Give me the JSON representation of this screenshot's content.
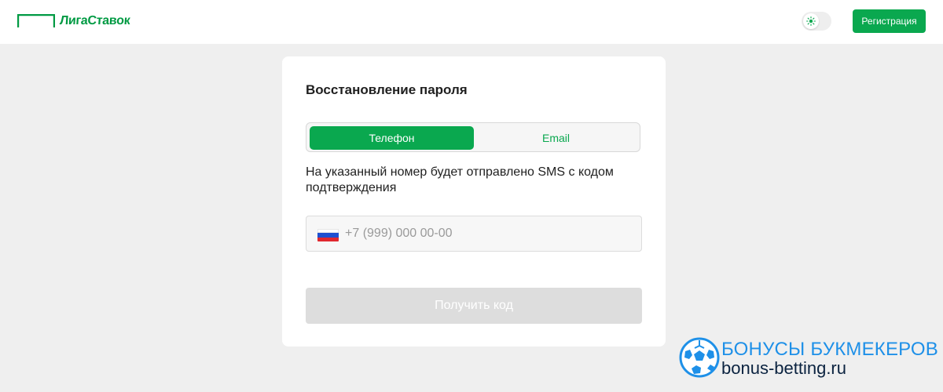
{
  "header": {
    "logo_text": "ЛигаСтавок",
    "register_label": "Регистрация",
    "theme_toggle_icon": "sun-icon"
  },
  "card": {
    "title": "Восстановление пароля",
    "tabs": [
      {
        "label": "Телефон",
        "active": true
      },
      {
        "label": "Email",
        "active": false
      }
    ],
    "note": "На указанный номер будет отправлено SMS с кодом подтверждения",
    "phone": {
      "value": "",
      "placeholder": "+7 (999) 000 00-00",
      "flag_icon": "russia-flag-icon"
    },
    "submit_label": "Получить код",
    "submit_disabled": true
  },
  "watermark": {
    "line1": "БОНУСЫ БУКМЕКЕРОВ",
    "line2": "bonus-betting.ru"
  },
  "colors": {
    "brand_green": "#0aa84f",
    "logo_green": "#009a43",
    "page_bg": "#efefef",
    "disabled_button": "#dddddd",
    "watermark_blue": "#1e90e8",
    "watermark_dark": "#0b2340"
  }
}
